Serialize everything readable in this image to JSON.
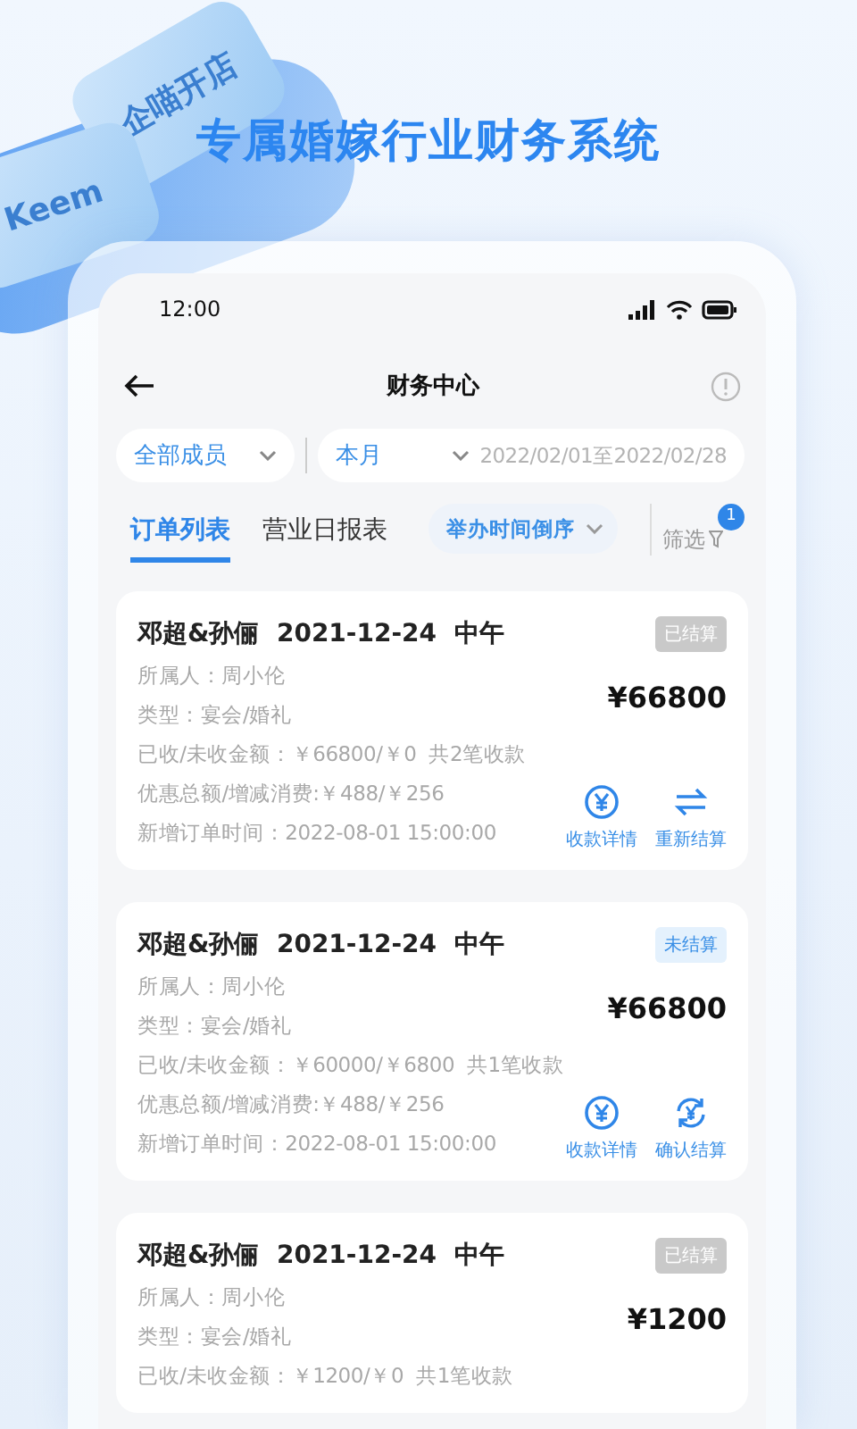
{
  "promo_title": "专属婚嫁行业财务系统",
  "decor_keys": [
    {
      "label": "企喵开店"
    },
    {
      "label": "Keem"
    }
  ],
  "status_bar": {
    "time": "12:00"
  },
  "header": {
    "title": "财务中心"
  },
  "filters": {
    "member": "全部成员",
    "period": "本月",
    "date_range": "2022/02/01至2022/02/28"
  },
  "tabs": [
    {
      "label": "订单列表",
      "selected": true
    },
    {
      "label": "营业日报表",
      "selected": false
    }
  ],
  "sort": {
    "label": "举办时间倒序"
  },
  "filter_button": {
    "label": "筛选",
    "badge": "1"
  },
  "orders": [
    {
      "couple": "邓超&孙俪",
      "date": "2021-12-24",
      "slot": "中午",
      "status": {
        "label": "已结算",
        "settled": true
      },
      "amount": "¥66800",
      "lines": [
        "所属人：周小伦",
        "类型：宴会/婚礼",
        "已收/未收金额：￥66800/￥0  共2笔收款",
        "优惠总额/增减消费:￥488/￥256",
        "新增订单时间：2022-08-01 15:00:00"
      ],
      "actions": [
        {
          "label": "收款详情",
          "kind": "yen"
        },
        {
          "label": "重新结算",
          "kind": "exchange"
        }
      ]
    },
    {
      "couple": "邓超&孙俪",
      "date": "2021-12-24",
      "slot": "中午",
      "status": {
        "label": "未结算",
        "settled": false
      },
      "amount": "¥66800",
      "lines": [
        "所属人：周小伦",
        "类型：宴会/婚礼",
        "已收/未收金额：￥60000/￥6800  共1笔收款",
        "优惠总额/增减消费:￥488/￥256",
        "新增订单时间：2022-08-01 15:00:00"
      ],
      "actions": [
        {
          "label": "收款详情",
          "kind": "yen"
        },
        {
          "label": "确认结算",
          "kind": "refresh"
        }
      ]
    },
    {
      "couple": "邓超&孙俪",
      "date": "2021-12-24",
      "slot": "中午",
      "status": {
        "label": "已结算",
        "settled": true
      },
      "amount": "¥1200",
      "lines": [
        "所属人：周小伦",
        "类型：宴会/婚礼",
        "已收/未收金额：￥1200/￥0  共1笔收款"
      ]
    }
  ]
}
